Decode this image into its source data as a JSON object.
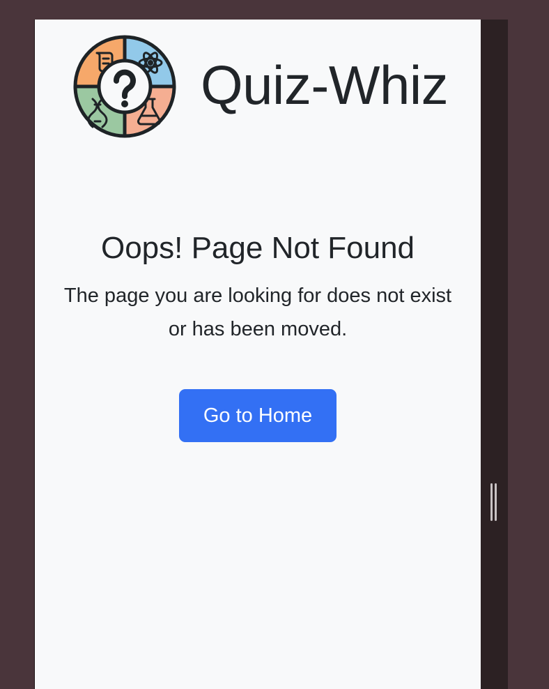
{
  "header": {
    "brand": "Quiz-Whiz",
    "logo_icon": "quiz-whiz-logo-icon"
  },
  "main": {
    "title": "Oops! Page Not Found",
    "message": "The page you are looking for does not exist or has been moved.",
    "home_button_label": "Go to Home"
  },
  "colors": {
    "page_background": "#f8f9fa",
    "outer_background": "#4a353b",
    "button": "#3370f4",
    "text": "#212529",
    "logo_orange": "#f6a86a",
    "logo_blue": "#92c9e9",
    "logo_green": "#9bc8a1",
    "logo_salmon": "#f5ae92"
  }
}
